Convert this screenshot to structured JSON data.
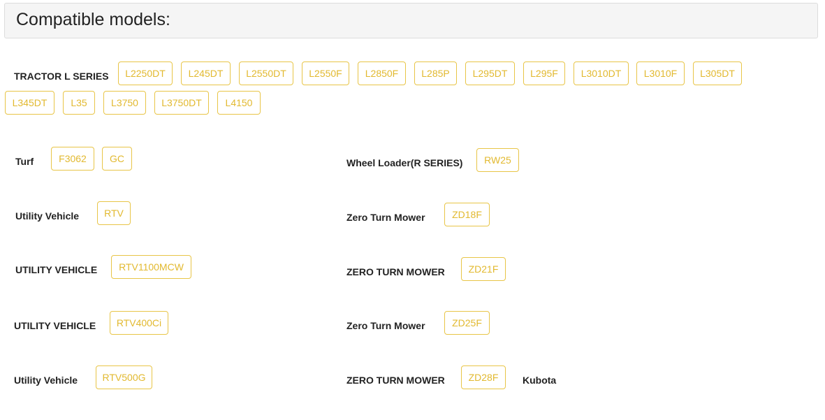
{
  "page_title": "Compatible models:",
  "colors": {
    "tag_border": "#e8c547",
    "tag_text": "#e2b92f",
    "header_bg": "#f5f5f5"
  },
  "tractor_l_series": {
    "label": "TRACTOR L SERIES",
    "models": [
      "L2250DT",
      "L245DT",
      "L2550DT",
      "L2550F",
      "L2850F",
      "L285P",
      "L295DT",
      "L295F",
      "L3010DT",
      "L3010F",
      "L305DT",
      "L345DT",
      "L35",
      "L3750",
      "L3750DT",
      "L4150"
    ]
  },
  "turf": {
    "label": "Turf",
    "models": [
      "F3062",
      "GC"
    ]
  },
  "wheel_loader": {
    "label": "Wheel Loader(R SERIES)",
    "models": [
      "RW25"
    ]
  },
  "utility_vehicle_1": {
    "label": "Utility Vehicle",
    "models": [
      "RTV"
    ]
  },
  "zero_turn_mower_1": {
    "label": "Zero Turn Mower",
    "models": [
      "ZD18F"
    ]
  },
  "utility_vehicle_2": {
    "label": "UTILITY VEHICLE",
    "models": [
      "RTV1100MCW"
    ]
  },
  "zero_turn_mower_2": {
    "label": "ZERO TURN MOWER",
    "models": [
      "ZD21F"
    ]
  },
  "utility_vehicle_3": {
    "label": "UTILITY VEHICLE",
    "models": [
      "RTV400Ci"
    ]
  },
  "zero_turn_mower_3": {
    "label": "Zero Turn Mower",
    "models": [
      "ZD25F"
    ]
  },
  "utility_vehicle_4": {
    "label": "Utility Vehicle",
    "models": [
      "RTV500G"
    ]
  },
  "zero_turn_mower_4": {
    "label": "ZERO TURN MOWER",
    "models": [
      "ZD28F"
    ]
  },
  "brand": {
    "label": "Kubota"
  }
}
